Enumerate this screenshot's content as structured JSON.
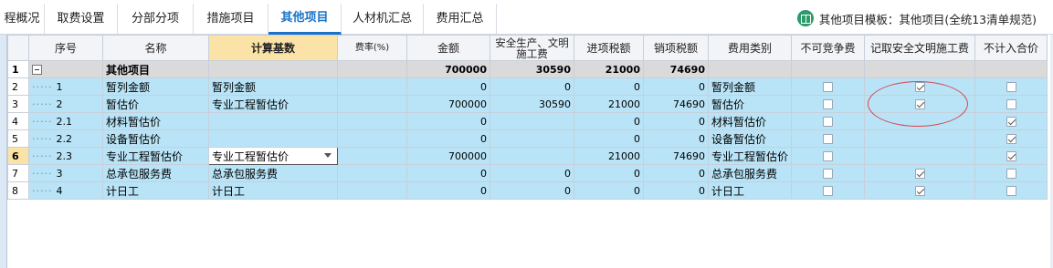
{
  "tabs": [
    {
      "label": "程概况"
    },
    {
      "label": "取费设置"
    },
    {
      "label": "分部分项"
    },
    {
      "label": "措施项目"
    },
    {
      "label": "其他项目"
    },
    {
      "label": "人材机汇总"
    },
    {
      "label": "费用汇总"
    }
  ],
  "active_tab": "其他项目",
  "template_info": "其他项目模板：其他项目(全统13清单规范)",
  "columns": {
    "seq": "序号",
    "name": "名称",
    "basis": "计算基数",
    "rate": "费率(%)",
    "amount": "金额",
    "safety": "安全生产、文明施工费",
    "input_tax": "进项税额",
    "output_tax": "销项税额",
    "category": "费用类别",
    "non_competitive": "不可竞争费",
    "record_safety": "记取安全文明施工费",
    "exclude_total": "不计入合价"
  },
  "rows": [
    {
      "rn": "1",
      "seq": "",
      "name": "其他项目",
      "basis": "",
      "rate": "",
      "amount": "700000",
      "safety": "30590",
      "input_tax": "21000",
      "output_tax": "74690",
      "category": "",
      "non_competitive": null,
      "record_safety": null,
      "exclude_total": null
    },
    {
      "rn": "2",
      "seq": "1",
      "name": "暂列金额",
      "basis": "暂列金额",
      "rate": "",
      "amount": "0",
      "safety": "0",
      "input_tax": "0",
      "output_tax": "0",
      "category": "暂列金额",
      "non_competitive": false,
      "record_safety": true,
      "exclude_total": false
    },
    {
      "rn": "3",
      "seq": "2",
      "name": "暂估价",
      "basis": "专业工程暂估价",
      "rate": "",
      "amount": "700000",
      "safety": "30590",
      "input_tax": "21000",
      "output_tax": "74690",
      "category": "暂估价",
      "non_competitive": false,
      "record_safety": true,
      "exclude_total": false
    },
    {
      "rn": "4",
      "seq": "2.1",
      "name": "材料暂估价",
      "basis": "",
      "rate": "",
      "amount": "0",
      "safety": "",
      "input_tax": "0",
      "output_tax": "0",
      "category": "材料暂估价",
      "non_competitive": false,
      "record_safety": null,
      "exclude_total": true
    },
    {
      "rn": "5",
      "seq": "2.2",
      "name": "设备暂估价",
      "basis": "",
      "rate": "",
      "amount": "0",
      "safety": "",
      "input_tax": "0",
      "output_tax": "0",
      "category": "设备暂估价",
      "non_competitive": false,
      "record_safety": null,
      "exclude_total": true
    },
    {
      "rn": "6",
      "seq": "2.3",
      "name": "专业工程暂估价",
      "basis": "专业工程暂估价",
      "rate": "",
      "amount": "700000",
      "safety": "",
      "input_tax": "21000",
      "output_tax": "74690",
      "category": "专业工程暂估价",
      "non_competitive": false,
      "record_safety": null,
      "exclude_total": true
    },
    {
      "rn": "7",
      "seq": "3",
      "name": "总承包服务费",
      "basis": "总承包服务费",
      "rate": "",
      "amount": "0",
      "safety": "0",
      "input_tax": "0",
      "output_tax": "0",
      "category": "总承包服务费",
      "non_competitive": false,
      "record_safety": true,
      "exclude_total": false
    },
    {
      "rn": "8",
      "seq": "4",
      "name": "计日工",
      "basis": "计日工",
      "rate": "",
      "amount": "0",
      "safety": "0",
      "input_tax": "0",
      "output_tax": "0",
      "category": "计日工",
      "non_competitive": false,
      "record_safety": true,
      "exclude_total": false
    }
  ],
  "colors": {
    "row_bg": "#b9e4f7",
    "top_row_bg": "#dadada",
    "selected_header": "#fbe3a8",
    "active_tab": "#1a73c9",
    "annotation": "#d8464f"
  }
}
